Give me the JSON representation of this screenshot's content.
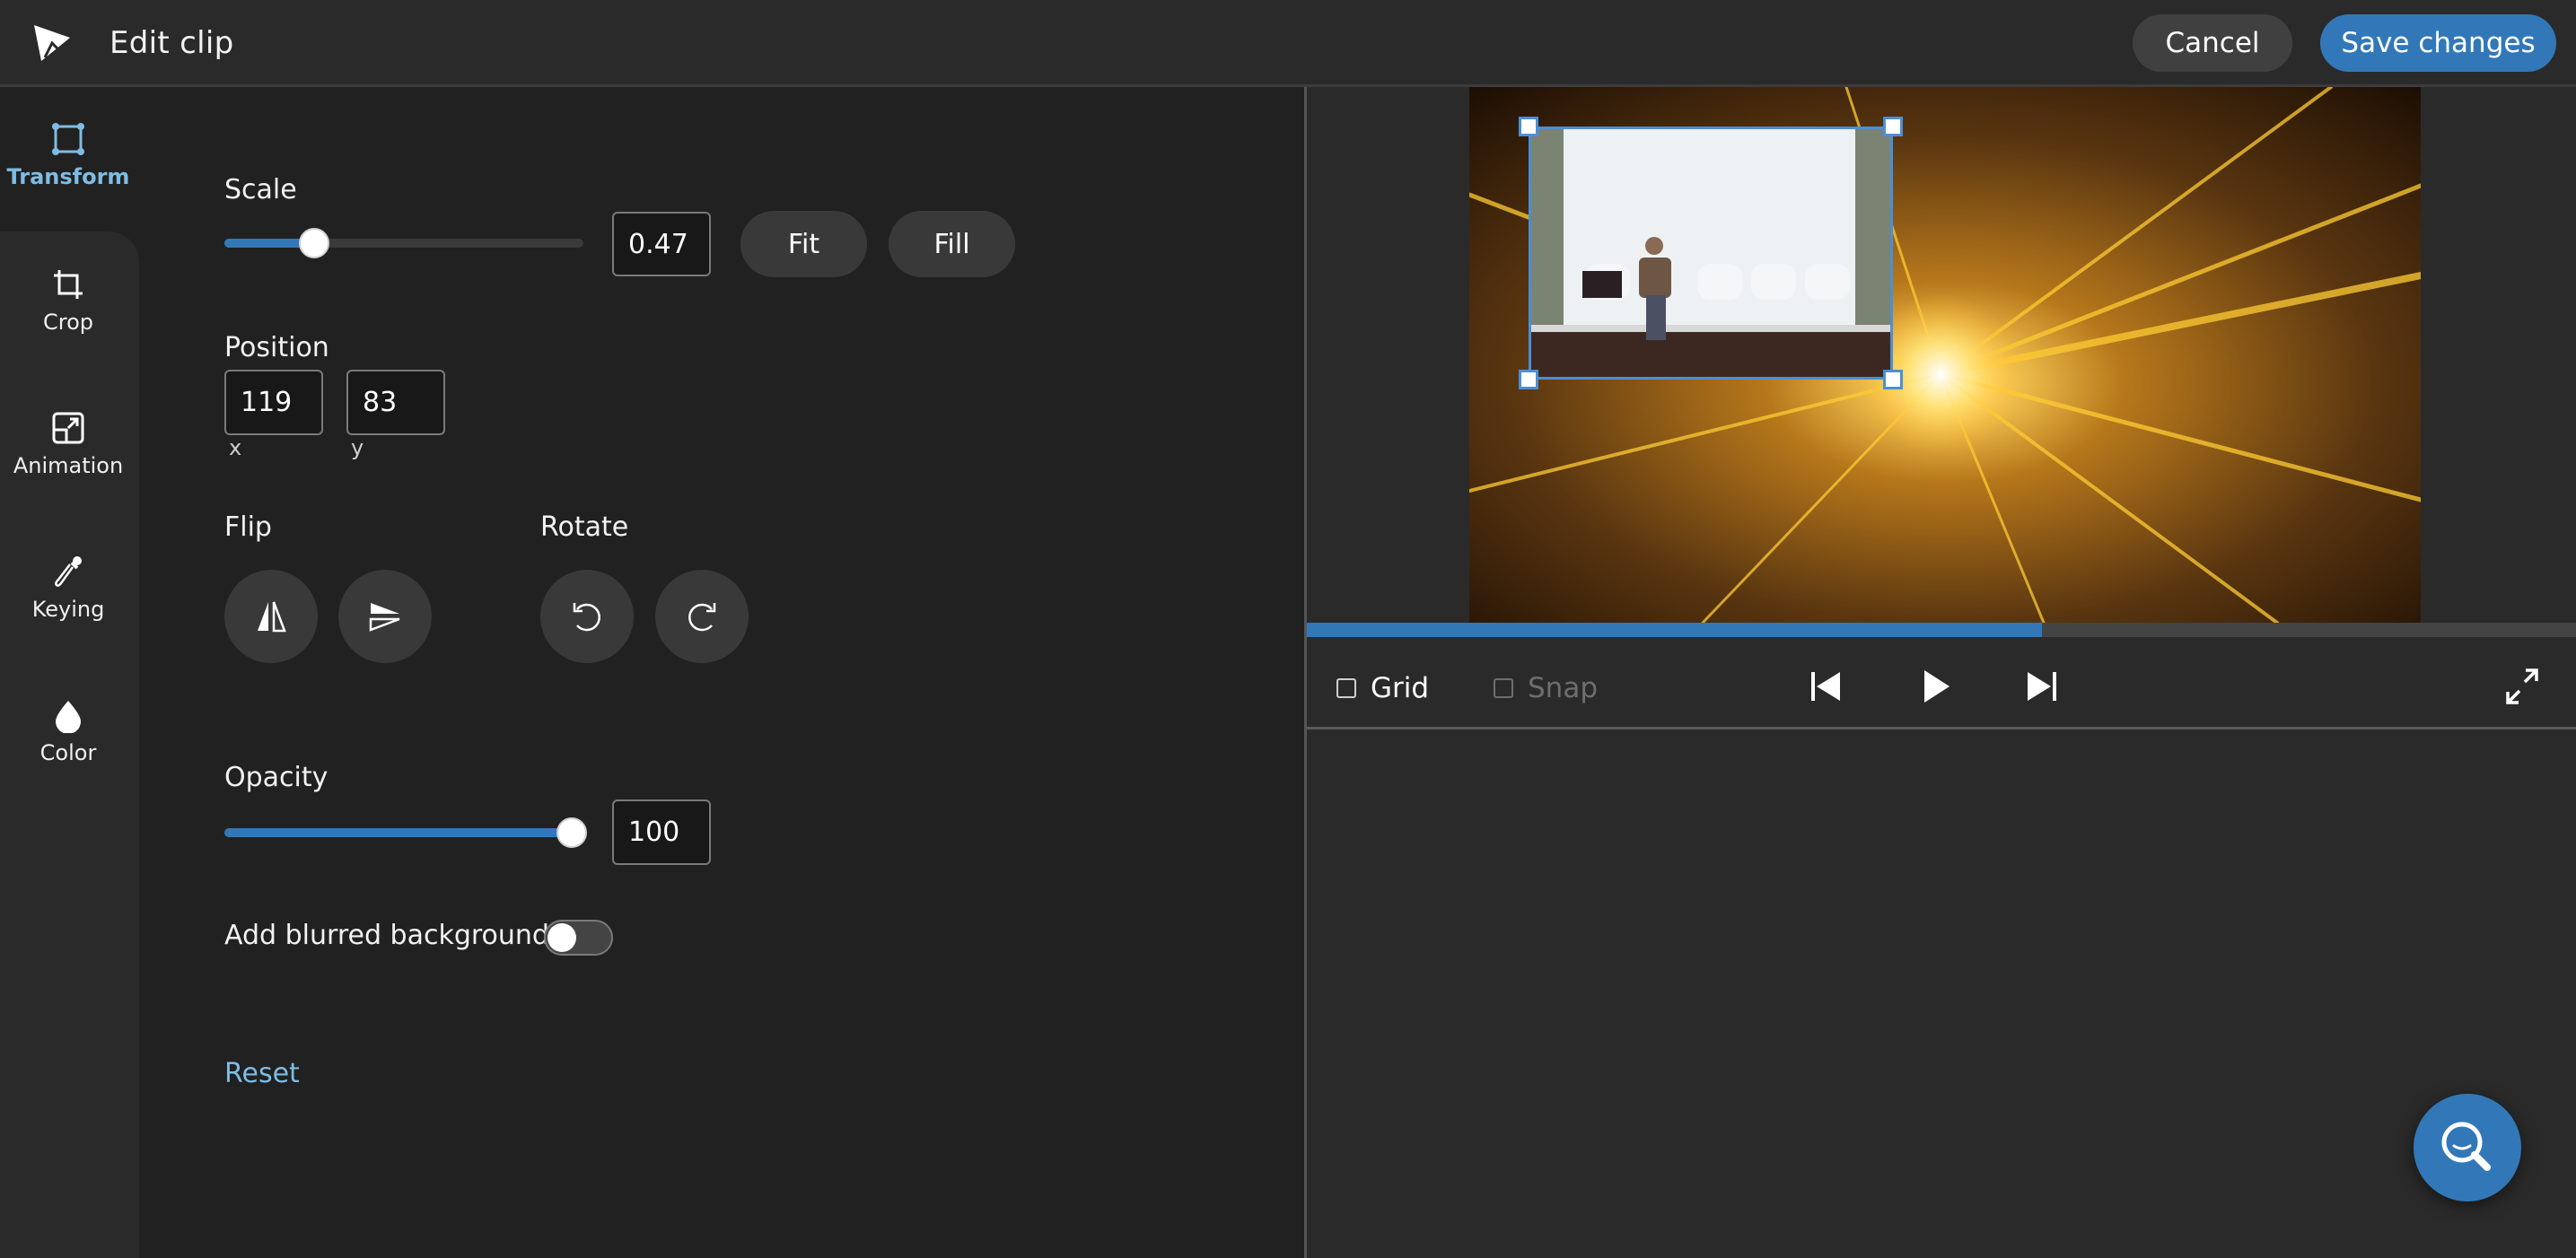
{
  "header": {
    "title": "Edit clip",
    "cancel_label": "Cancel",
    "save_label": "Save changes",
    "logo_icon": "app-logo-icon"
  },
  "sidebar": {
    "items": [
      {
        "label": "Transform",
        "icon": "transform-icon",
        "active": true
      },
      {
        "label": "Crop",
        "icon": "crop-icon",
        "active": false
      },
      {
        "label": "Animation",
        "icon": "animation-icon",
        "active": false
      },
      {
        "label": "Keying",
        "icon": "eyedropper-icon",
        "active": false
      },
      {
        "label": "Color",
        "icon": "droplet-icon",
        "active": false
      }
    ]
  },
  "transform": {
    "scale": {
      "label": "Scale",
      "value": "0.47",
      "slider_fraction": 0.25,
      "fit_label": "Fit",
      "fill_label": "Fill"
    },
    "position": {
      "label": "Position",
      "x_value": "119",
      "y_value": "83",
      "x_label": "x",
      "y_label": "y"
    },
    "flip": {
      "label": "Flip",
      "buttons": [
        "flip-horizontal-icon",
        "flip-vertical-icon"
      ]
    },
    "rotate": {
      "label": "Rotate",
      "buttons": [
        "rotate-left-icon",
        "rotate-right-icon"
      ]
    },
    "opacity": {
      "label": "Opacity",
      "value": "100",
      "slider_fraction": 1.0
    },
    "blurred_background": {
      "label": "Add blurred background",
      "enabled": false
    },
    "reset_label": "Reset"
  },
  "preview": {
    "progress_fraction": 0.578,
    "grid_label": "Grid",
    "grid_checked": false,
    "snap_label": "Snap",
    "snap_checked": false,
    "snap_disabled": true,
    "controls": [
      "skip-back-icon",
      "play-icon",
      "skip-forward-icon",
      "fullscreen-icon"
    ]
  },
  "colors": {
    "accent": "#3278b8",
    "active_tab": "#7fbce4",
    "selection_border": "#4a8fd8"
  },
  "fab": {
    "icon": "search-help-icon"
  }
}
